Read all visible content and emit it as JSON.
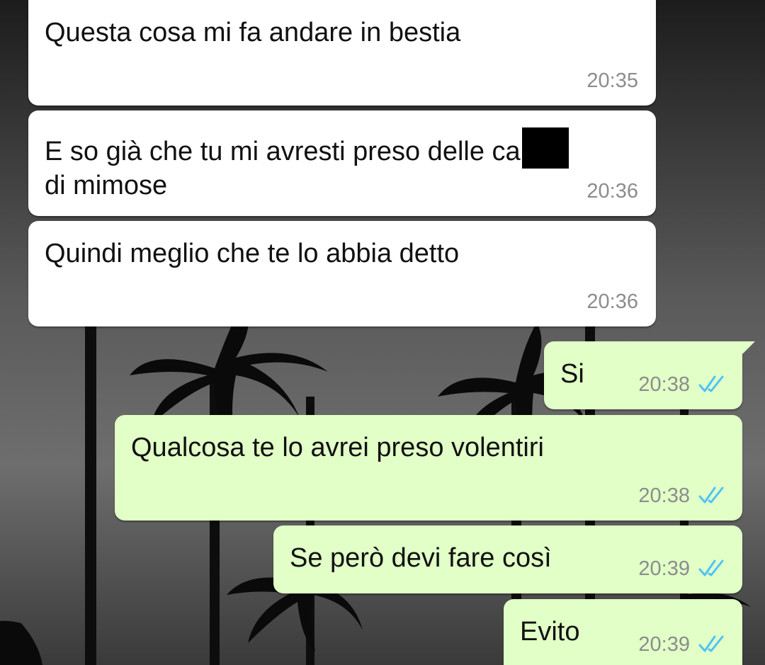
{
  "messages": [
    {
      "direction": "incoming",
      "text": "Questa cosa mi fa andare in bestia",
      "time": "20:35"
    },
    {
      "direction": "incoming",
      "text_line1": "E so già che tu mi avresti preso delle ca",
      "text_line2": "di mimose",
      "time": "20:36",
      "redacted": true
    },
    {
      "direction": "incoming",
      "text": "Quindi meglio che te lo abbia detto",
      "time": "20:36"
    },
    {
      "direction": "outgoing",
      "text": "Si",
      "time": "20:38",
      "status": "read"
    },
    {
      "direction": "outgoing",
      "text": "Qualcosa te lo avrei preso volentiri",
      "time": "20:38",
      "status": "read"
    },
    {
      "direction": "outgoing",
      "text": "Se però devi fare così",
      "time": "20:39",
      "status": "read"
    },
    {
      "direction": "outgoing",
      "text": "Evito",
      "time": "20:39",
      "status": "read"
    }
  ],
  "colors": {
    "incoming_bubble": "#ffffff",
    "outgoing_bubble": "#e1ffc7",
    "read_ticks": "#4fc3f7",
    "timestamp": "#8c8c8c"
  },
  "icons": {
    "read_status": "double-check-icon",
    "wallpaper": "palm-trees-wallpaper"
  }
}
